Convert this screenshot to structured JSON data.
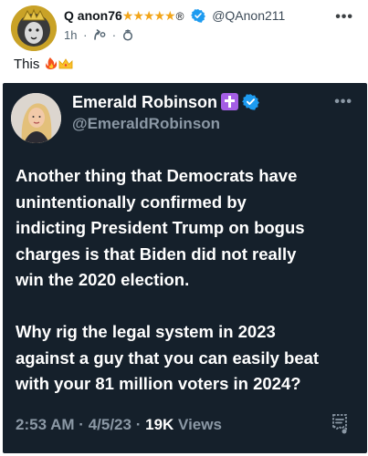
{
  "post": {
    "author_name": "Q anon76",
    "stars": "★★★★★",
    "registered_mark": "®",
    "handle": "@QAnon211",
    "time": "1h",
    "separator": "·",
    "text": "This",
    "more_icon": "more-horizontal-icon"
  },
  "embed": {
    "name": "Emerald Robinson",
    "handle": "@EmeraldRobinson",
    "body": [
      "Another thing that Democrats have",
      "unintentionally confirmed by",
      "indicting President Trump on bogus",
      "charges is that Biden did not really",
      "win the 2020 election.",
      "Why rig the legal system in 2023",
      "against a guy that you can easily beat",
      "with your 81 million voters in 2024?"
    ],
    "footer": {
      "time": "2:53 AM",
      "dot": "·",
      "date": "4/5/23",
      "views_count": "19K",
      "views_label": "Views"
    }
  },
  "colors": {
    "embed_bg": "#15202b",
    "verified_blue": "#1d9bf0",
    "star_gold": "#f2a51a",
    "cross_purple": "#a45ee5"
  }
}
